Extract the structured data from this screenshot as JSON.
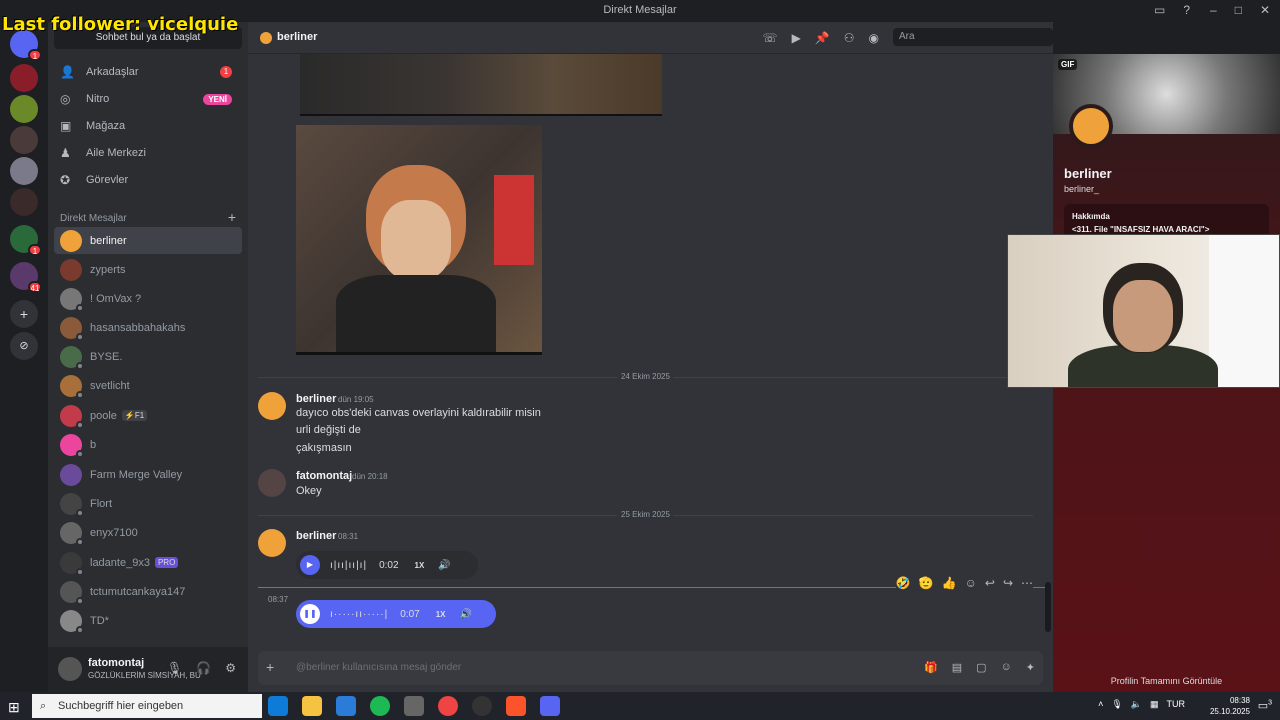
{
  "window": {
    "title": "Direkt Mesajlar"
  },
  "overlay": {
    "text": "Last follower: vicelquie"
  },
  "servers": {
    "badges": [
      "1",
      "1",
      "41"
    ]
  },
  "sidebar": {
    "search_label": "Sohbet bul ya da başlat",
    "nav": [
      {
        "label": "Arkadaşlar",
        "badge": "1",
        "icon": "friends-icon"
      },
      {
        "label": "Nitro",
        "badge": "YENİ",
        "icon": "nitro-icon"
      },
      {
        "label": "Mağaza",
        "icon": "shop-icon"
      },
      {
        "label": "Aile Merkezi",
        "icon": "family-icon"
      },
      {
        "label": "Görevler",
        "icon": "quests-icon"
      }
    ],
    "dm_header": "Direkt Mesajlar",
    "dms": [
      {
        "name": "berliner",
        "active": true,
        "color": "#f0a23a"
      },
      {
        "name": "zyperts",
        "color": "#7a3b2e"
      },
      {
        "name": "! OmVax ?",
        "color": "#777777"
      },
      {
        "name": "hasansabbahakahs",
        "color": "#8a5a3a"
      },
      {
        "name": "BYSE.",
        "color": "#4a6b4a"
      },
      {
        "name": "svetlicht",
        "color": "#a86f3a"
      },
      {
        "name": "poole",
        "tag": "⚡F1",
        "color": "#c23b4a"
      },
      {
        "name": "b",
        "color": "#eb459e"
      },
      {
        "name": "Farm Merge Valley",
        "color": "#6a4a9a"
      },
      {
        "name": "Flort",
        "color": "#444444"
      },
      {
        "name": "enyx7100",
        "color": "#666666"
      },
      {
        "name": "ladante_9x3",
        "tag": "PRO",
        "color": "#3a3a3a"
      },
      {
        "name": "tctumutcankaya147",
        "color": "#555555"
      },
      {
        "name": "TD*",
        "color": "#888888"
      }
    ],
    "user": {
      "name": "fatomontaj",
      "status": "GÖZLÜKLERİM SİMSİYAH, BU ..."
    }
  },
  "chat": {
    "header_name": "berliner",
    "search_placeholder": "Ara",
    "dividers": [
      "24 Ekim 2025",
      "25 Ekim 2025"
    ],
    "messages": [
      {
        "author": "berliner",
        "time": "dün 19:05",
        "lines": [
          "dayıco obs'deki canvas overlayini kaldırabilir misin",
          "urli değişti de",
          "çakışmasın"
        ]
      },
      {
        "author": "fatomontaj",
        "time": "dün 20:18",
        "lines": [
          "Okey"
        ]
      },
      {
        "author": "berliner",
        "time": "08:31",
        "voice": {
          "duration": "0:02",
          "speed": "1X"
        }
      }
    ],
    "pending": {
      "time": "08:37",
      "voice": {
        "duration": "0:07",
        "speed": "1X"
      }
    },
    "composer_placeholder": "@berliner kullanıcısına mesaj gönder"
  },
  "profile": {
    "gif_label": "GIF",
    "name": "berliner",
    "username": "berliner_",
    "about_title": "Hakkımda",
    "about_text": "<311. File \"INSAFSIZ HAVA ARACI\">",
    "full_profile": "Profilin Tamamını Görüntüle"
  },
  "taskbar": {
    "search_placeholder": "Suchbegriff hier eingeben",
    "lang": "TUR",
    "time": "08:38",
    "date": "25.10.2025",
    "notif_count": "3"
  }
}
